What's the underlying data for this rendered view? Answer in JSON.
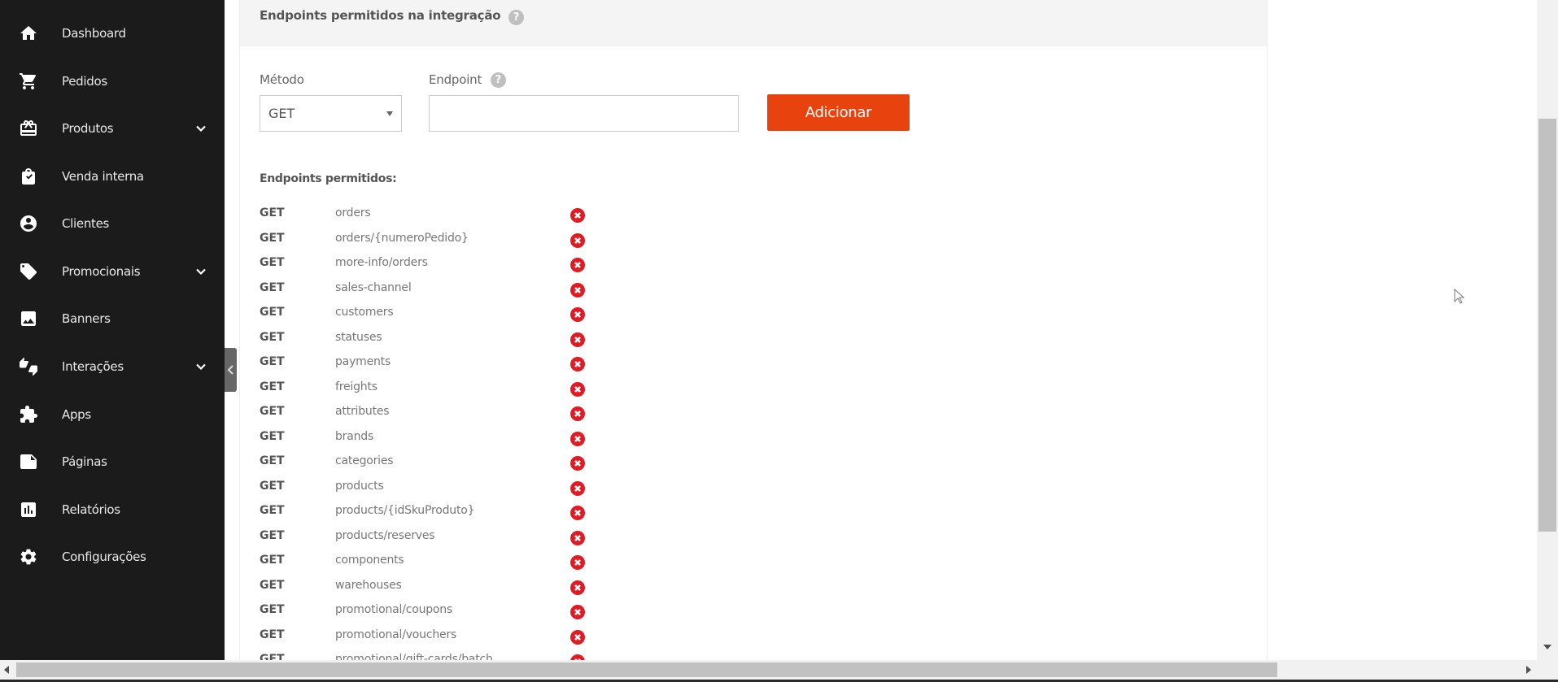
{
  "sidebar": {
    "items": [
      {
        "label": "Dashboard",
        "icon": "home-icon"
      },
      {
        "label": "Pedidos",
        "icon": "cart-icon"
      },
      {
        "label": "Produtos",
        "icon": "box-icon",
        "expandable": true
      },
      {
        "label": "Venda interna",
        "icon": "bag-icon"
      },
      {
        "label": "Clientes",
        "icon": "user-icon"
      },
      {
        "label": "Promocionais",
        "icon": "tag-icon",
        "expandable": true
      },
      {
        "label": "Banners",
        "icon": "image-icon"
      },
      {
        "label": "Interações",
        "icon": "thumbs-icon",
        "expandable": true
      },
      {
        "label": "Apps",
        "icon": "puzzle-icon"
      },
      {
        "label": "Páginas",
        "icon": "page-icon"
      },
      {
        "label": "Relatórios",
        "icon": "chart-icon"
      },
      {
        "label": "Configurações",
        "icon": "gear-icon"
      }
    ]
  },
  "section": {
    "title": "Endpoints permitidos na integração",
    "help": "?"
  },
  "form": {
    "method_label": "Método",
    "method_value": "GET",
    "endpoint_label": "Endpoint",
    "endpoint_help": "?",
    "endpoint_value": "",
    "add_label": "Adicionar"
  },
  "list": {
    "title": "Endpoints permitidos:",
    "rows": [
      {
        "method": "GET",
        "path": "orders"
      },
      {
        "method": "GET",
        "path": "orders/{numeroPedido}"
      },
      {
        "method": "GET",
        "path": "more-info/orders"
      },
      {
        "method": "GET",
        "path": "sales-channel"
      },
      {
        "method": "GET",
        "path": "customers"
      },
      {
        "method": "GET",
        "path": "statuses"
      },
      {
        "method": "GET",
        "path": "payments"
      },
      {
        "method": "GET",
        "path": "freights"
      },
      {
        "method": "GET",
        "path": "attributes"
      },
      {
        "method": "GET",
        "path": "brands"
      },
      {
        "method": "GET",
        "path": "categories"
      },
      {
        "method": "GET",
        "path": "products"
      },
      {
        "method": "GET",
        "path": "products/{idSkuProduto}"
      },
      {
        "method": "GET",
        "path": "products/reserves"
      },
      {
        "method": "GET",
        "path": "components"
      },
      {
        "method": "GET",
        "path": "warehouses"
      },
      {
        "method": "GET",
        "path": "promotional/coupons"
      },
      {
        "method": "GET",
        "path": "promotional/vouchers"
      },
      {
        "method": "GET",
        "path": "promotional/gift-cards/batch"
      }
    ]
  },
  "colors": {
    "sidebar_bg": "#1b1b1b",
    "accent": "#e8420e",
    "delete": "#e01b24"
  }
}
